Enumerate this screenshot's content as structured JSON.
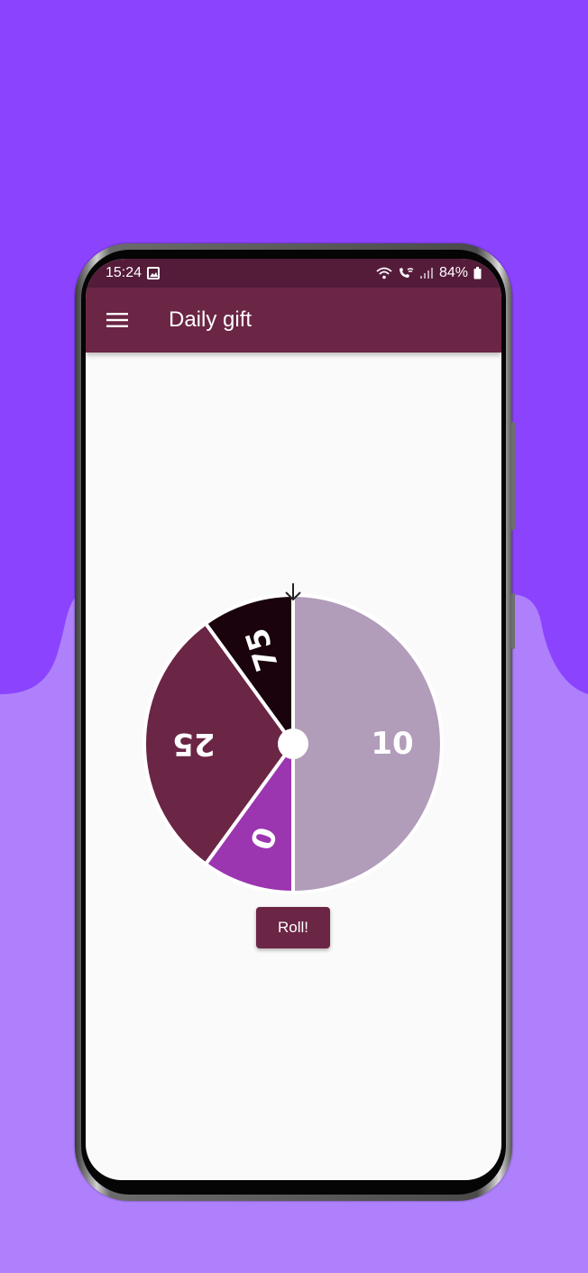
{
  "status_bar": {
    "time": "15:24",
    "battery": "84%",
    "icons": [
      "image-icon",
      "wifi-icon",
      "wifi-call-icon",
      "signal-icon",
      "battery-icon"
    ]
  },
  "app_bar": {
    "title": "Daily gift",
    "menu_icon": "menu-icon"
  },
  "wheel": {
    "pointer_icon": "arrow-down-icon",
    "segments": [
      {
        "label": "10",
        "fraction": 0.5,
        "color": "#b19cba"
      },
      {
        "label": "0",
        "fraction": 0.1,
        "color": "#9c35b0"
      },
      {
        "label": "25",
        "fraction": 0.3,
        "color": "#6b2545"
      },
      {
        "label": "75",
        "fraction": 0.1,
        "color": "#1a030d"
      }
    ]
  },
  "roll_button": {
    "label": "Roll!"
  },
  "colors": {
    "background_top": "#8c43fe",
    "background_bottom": "#ae80fb",
    "primary": "#6b2545",
    "status_bar": "#551c3a"
  }
}
